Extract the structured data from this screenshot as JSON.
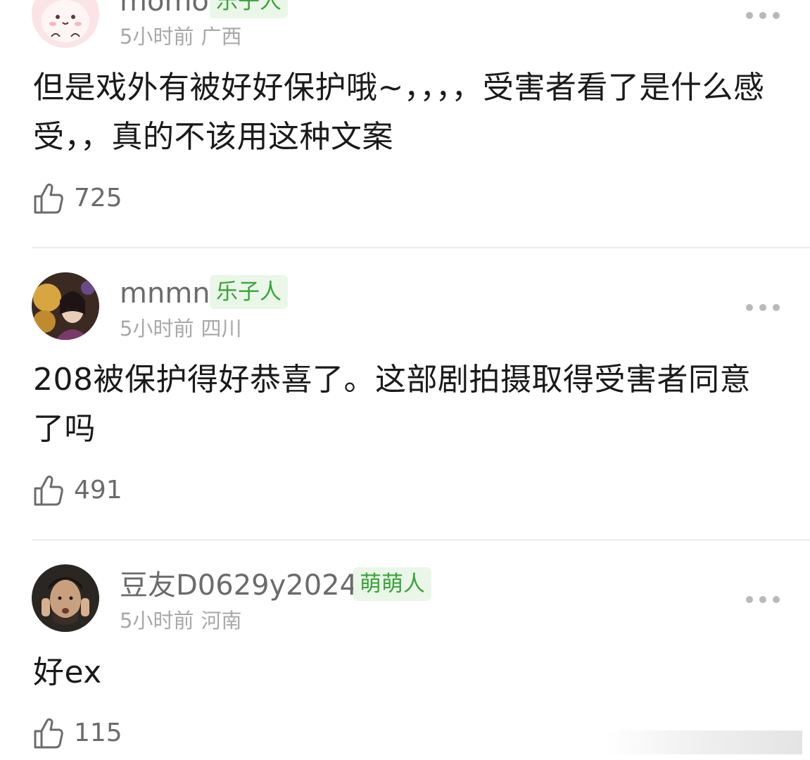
{
  "comments": [
    {
      "username": "momo",
      "badge": "乐子人",
      "time": "5小时前",
      "location": "广西",
      "content": "但是戏外有被好好保护哦~，，，，受害者看了是什么感受，，真的不该用这种文案",
      "likes": "725",
      "avatar_icon": "cartoon-bunny-avatar"
    },
    {
      "username": "mnmn",
      "badge": "乐子人",
      "time": "5小时前",
      "location": "四川",
      "content": "208被保护得好恭喜了。这部剧拍摄取得受害者同意了吗",
      "likes": "491",
      "avatar_icon": "drama-still-avatar"
    },
    {
      "username": "豆友D0629y2024",
      "badge": "萌萌人",
      "time": "5小时前",
      "location": "河南",
      "content": "好ex",
      "likes": "115",
      "avatar_icon": "man-portrait-avatar"
    }
  ],
  "colors": {
    "badge_bg": "#eaf7e8",
    "badge_text": "#3aa33a",
    "username": "#6b6b6b",
    "meta": "#a8a8a8",
    "content": "#1a1a1a"
  },
  "icons": {
    "like": "thumbs-up-icon",
    "more": "more-dots-icon"
  }
}
